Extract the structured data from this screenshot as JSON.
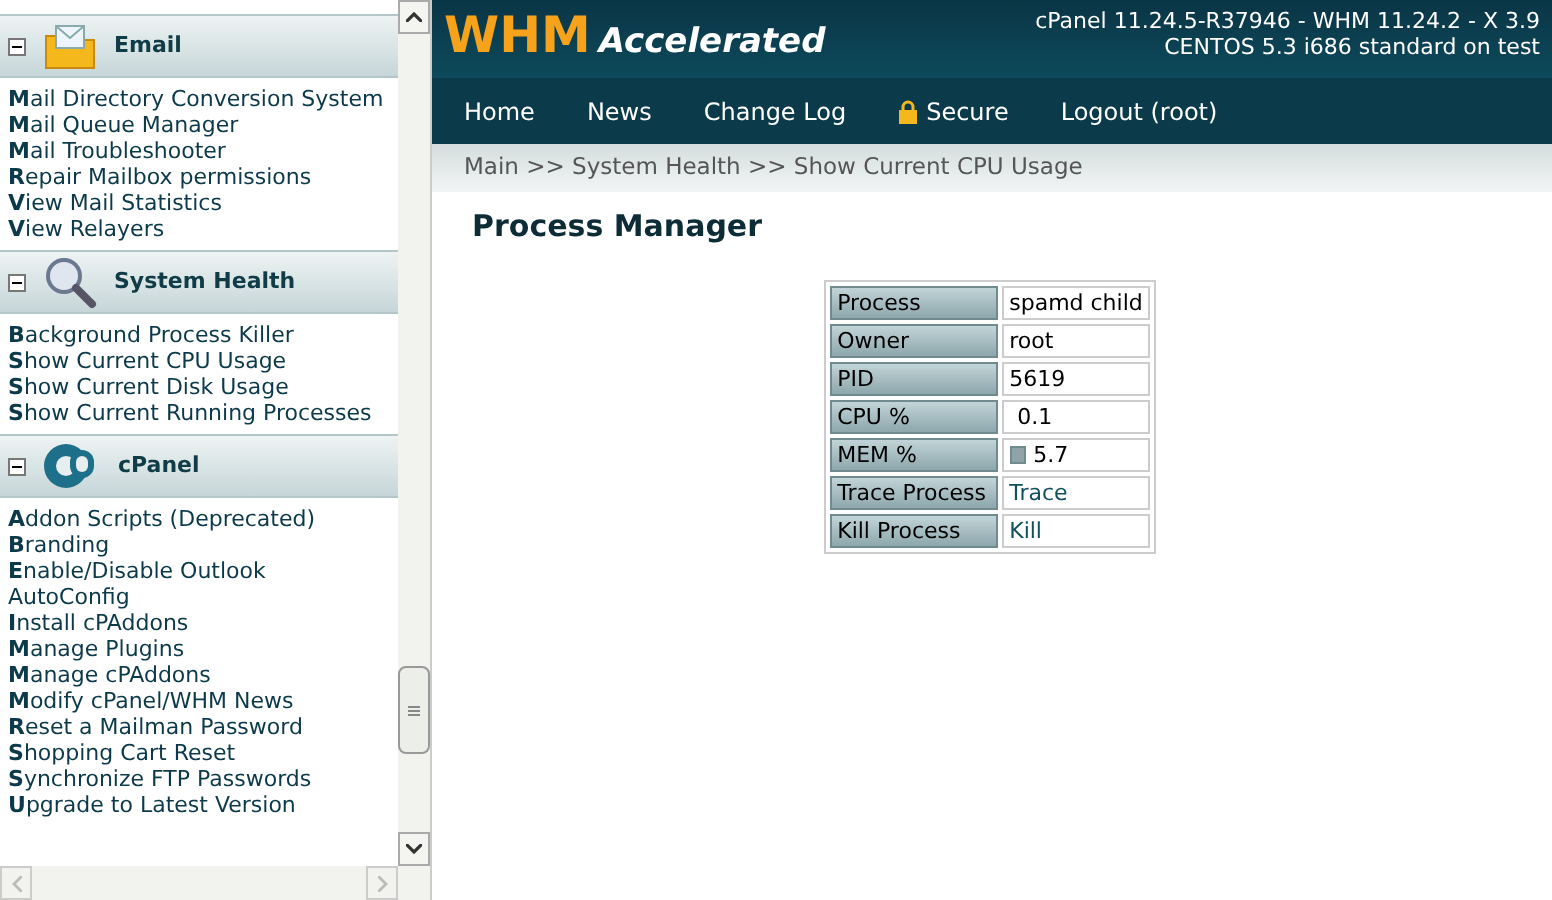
{
  "sidebar": {
    "sections": [
      {
        "title": "Email",
        "kind": "envelope",
        "expanded": true,
        "items": [
          "**M**ail Directory Conversion System",
          "**M**ail Queue Manager",
          "**M**ail Troubleshooter",
          "**R**epair Mailbox permissions",
          "**V**iew Mail Statistics",
          "**V**iew Relayers"
        ]
      },
      {
        "title": "System Health",
        "kind": "magnifier",
        "expanded": true,
        "items": [
          "**B**ackground Process Killer",
          "**S**how Current CPU Usage",
          "**S**how Current Disk Usage",
          "**S**how Current Running Processes"
        ]
      },
      {
        "title": "cPanel",
        "kind": "cp",
        "expanded": true,
        "items": [
          "**A**ddon Scripts (Deprecated)",
          "**B**randing",
          "**E**nable/Disable Outlook AutoConfig",
          "**I**nstall cPAddons",
          "**M**anage Plugins",
          "**M**anage cPAddons",
          "**M**odify cPanel/WHM News",
          "**R**eset a Mailman Password",
          "**S**hopping Cart Reset",
          "**S**ynchronize FTP Passwords",
          "**U**pgrade to Latest Version"
        ]
      }
    ]
  },
  "header": {
    "logo_main": "WHM",
    "logo_sub": "Accelerated",
    "version_lines": [
      "cPanel 11.24.5-R37946 - WHM 11.24.2 - X 3.9",
      "CENTOS 5.3 i686 standard on test"
    ]
  },
  "nav": [
    {
      "label": "Home",
      "kind": "plain"
    },
    {
      "label": "News",
      "kind": "plain"
    },
    {
      "label": "Change Log",
      "kind": "plain"
    },
    {
      "label": "Secure",
      "kind": "lock"
    },
    {
      "label": "Logout (root)",
      "kind": "plain"
    }
  ],
  "breadcrumb": "Main >> System Health >> Show Current CPU Usage",
  "page_title": "Process Manager",
  "table": {
    "rows": [
      {
        "label": "Process",
        "kind": "text",
        "value": "spamd child"
      },
      {
        "label": "Owner",
        "kind": "text",
        "value": "root"
      },
      {
        "label": "PID",
        "kind": "text",
        "value": "5619"
      },
      {
        "label": "CPU %",
        "kind": "text",
        "value": "0.1"
      },
      {
        "label": "MEM %",
        "kind": "bar",
        "value": "5.7",
        "level": 0.057
      },
      {
        "label": "Trace Process",
        "kind": "link",
        "value": "Trace"
      },
      {
        "label": "Kill Process",
        "kind": "link",
        "value": "Kill"
      }
    ]
  }
}
